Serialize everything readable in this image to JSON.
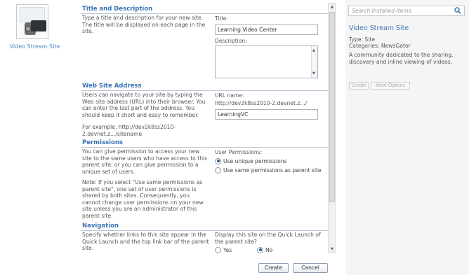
{
  "template": {
    "name": "Video Stream Site"
  },
  "sections": {
    "title_desc": {
      "heading": "Title and Description",
      "description": "Type a title and description for your new site. The title will be displayed on each page in the site.",
      "title_label": "Title:",
      "title_value": "Learning Video Center",
      "description_label": "Description:",
      "description_value": ""
    },
    "address": {
      "heading": "Web Site Address",
      "description": "Users can navigate to your site by typing the Web site address (URL) into their browser. You can enter the last part of the address. You should keep it short and easy to remember.",
      "example": "For example, http://dev2k8ss2010-2.devnet.z.../sitename",
      "url_label": "URL name:",
      "url_prefix": "http://dev2k8ss2010-2.devnet.z.../",
      "url_value": "LearningVC"
    },
    "permissions": {
      "heading": "Permissions",
      "description": "You can give permission to access your new site to the same users who have access to this parent site, or you can give permission to a unique set of users.",
      "note": "Note: If you select \"Use same permissions as parent site\", one set of user permissions is shared by both sites. Consequently, you cannot change user permissions on your new site unless you are an administrator of this parent site.",
      "label": "User Permissions:",
      "option_unique": "Use unique permissions",
      "option_same": "Use same permissions as parent site",
      "selected": "unique"
    },
    "navigation": {
      "heading": "Navigation",
      "description": "Specify whether links to this site appear in the Quick Launch and the top link bar of the parent site.",
      "question": "Display this site on the Quick Launch of the parent site?",
      "option_yes": "Yes",
      "option_no": "No",
      "selected": "no"
    }
  },
  "buttons": {
    "create": "Create",
    "cancel": "Cancel"
  },
  "details": {
    "search_placeholder": "Search Installed Items",
    "title": "Video Stream Site",
    "type": "Type: Site",
    "categories": "Categories: NewsGator",
    "description": "A community dedicated to the sharing, discovery and inline viewing of videos.",
    "create_label": "Create",
    "options_label": "More Options"
  },
  "icons": {
    "search": "search-icon",
    "template": "video-camera-icon"
  },
  "colors": {
    "accent": "#3a74b3",
    "rule": "#b8c7d6",
    "panel_bg": "#f5f5f5"
  }
}
